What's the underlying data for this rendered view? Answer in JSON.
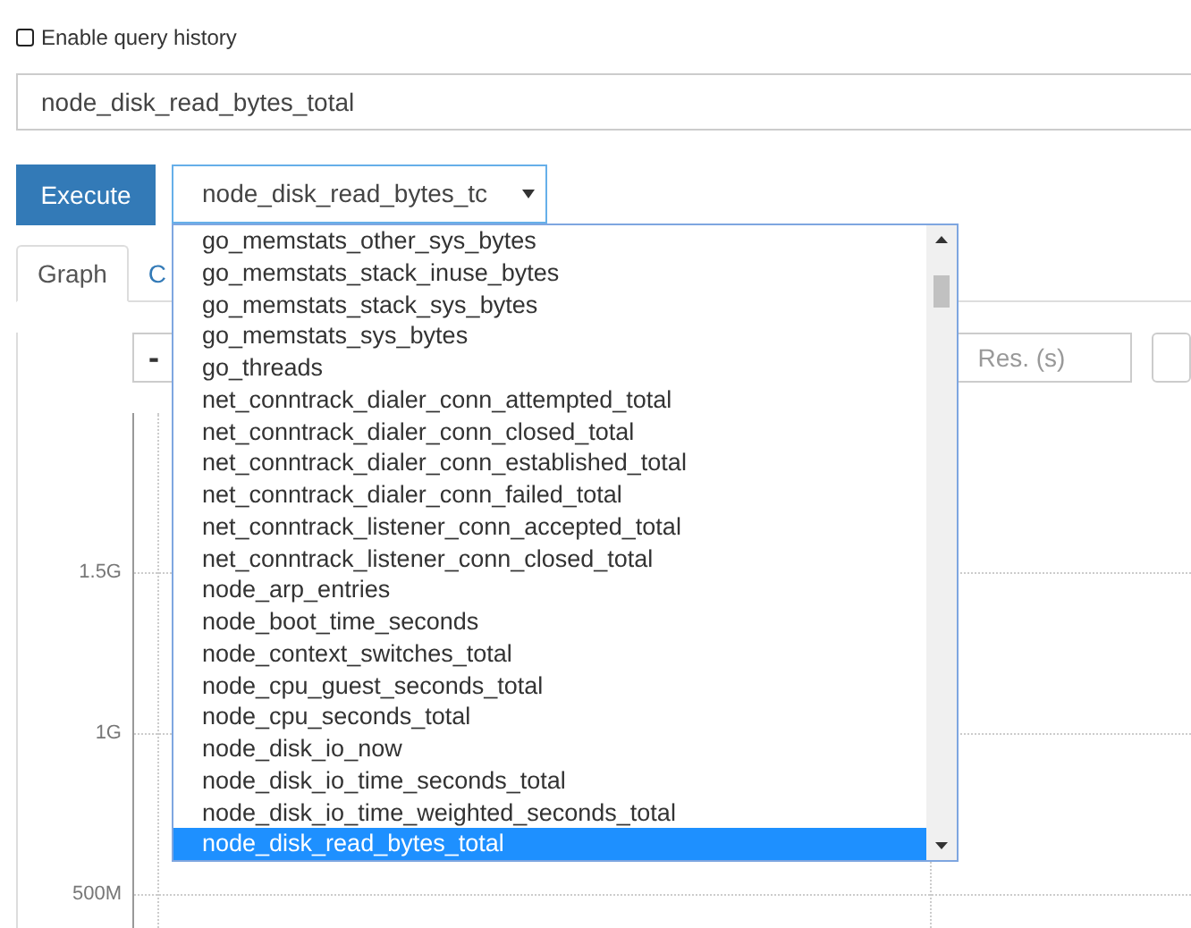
{
  "query_history": {
    "label": "Enable query history",
    "checked": false
  },
  "expression": {
    "value": "node_disk_read_bytes_total"
  },
  "execute_button": "Execute",
  "metric_select": {
    "value": "node_disk_read_bytes_tc",
    "options": [
      {
        "label": "go_memstats_other_sys_bytes",
        "selected": false
      },
      {
        "label": "go_memstats_stack_inuse_bytes",
        "selected": false
      },
      {
        "label": "go_memstats_stack_sys_bytes",
        "selected": false
      },
      {
        "label": "go_memstats_sys_bytes",
        "selected": false
      },
      {
        "label": "go_threads",
        "selected": false
      },
      {
        "label": "net_conntrack_dialer_conn_attempted_total",
        "selected": false
      },
      {
        "label": "net_conntrack_dialer_conn_closed_total",
        "selected": false
      },
      {
        "label": "net_conntrack_dialer_conn_established_total",
        "selected": false
      },
      {
        "label": "net_conntrack_dialer_conn_failed_total",
        "selected": false
      },
      {
        "label": "net_conntrack_listener_conn_accepted_total",
        "selected": false
      },
      {
        "label": "net_conntrack_listener_conn_closed_total",
        "selected": false
      },
      {
        "label": "node_arp_entries",
        "selected": false
      },
      {
        "label": "node_boot_time_seconds",
        "selected": false
      },
      {
        "label": "node_context_switches_total",
        "selected": false
      },
      {
        "label": "node_cpu_guest_seconds_total",
        "selected": false
      },
      {
        "label": "node_cpu_seconds_total",
        "selected": false
      },
      {
        "label": "node_disk_io_now",
        "selected": false
      },
      {
        "label": "node_disk_io_time_seconds_total",
        "selected": false
      },
      {
        "label": "node_disk_io_time_weighted_seconds_total",
        "selected": false
      },
      {
        "label": "node_disk_read_bytes_total",
        "selected": true
      }
    ]
  },
  "tabs": [
    {
      "label": "Graph",
      "selected": true
    },
    {
      "label": "C",
      "selected": false
    }
  ],
  "toolbar": {
    "range_minus": "-",
    "resolution": {
      "placeholder": "Res. (s)"
    }
  },
  "graph": {
    "y_ticks": [
      "1.5G",
      "1G",
      "500M"
    ]
  }
}
